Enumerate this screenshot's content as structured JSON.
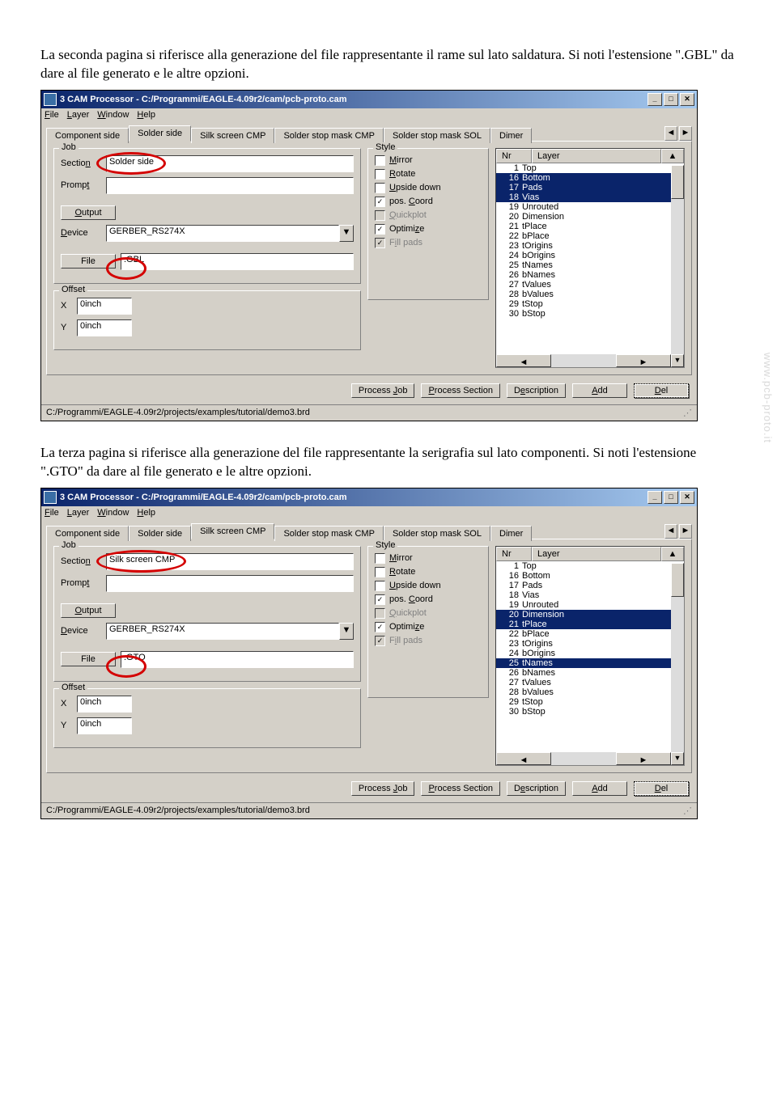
{
  "paragraph1": "La seconda pagina si riferisce alla generazione del file rappresentante il rame sul lato saldatura. Si noti l'estensione \".GBL\" da dare al file generato e le altre opzioni.",
  "paragraph2": "La terza pagina si riferisce alla generazione del file rappresentante la serigrafia sul lato componenti. Si noti l'estensione \".GTO\" da dare al file generato e le altre opzioni.",
  "watermark": "www.pcb-proto.it",
  "window": {
    "title": "3 CAM Processor - C:/Programmi/EAGLE-4.09r2/cam/pcb-proto.cam",
    "menu": [
      "File",
      "Layer",
      "Window",
      "Help"
    ],
    "tabs": [
      "Component side",
      "Solder side",
      "Silk screen CMP",
      "Solder stop mask CMP",
      "Solder stop mask SOL",
      "Dimer"
    ],
    "job_legend": "Job",
    "style_legend": "Style",
    "offset_legend": "Offset",
    "section_lbl": "Section",
    "prompt_lbl": "Prompt",
    "output_btn": "Output",
    "device_lbl": "Device",
    "device_val": "GERBER_RS274X",
    "file_btn": "File",
    "offset_x": "X",
    "offset_y": "Y",
    "offset_x_val": "0inch",
    "offset_y_val": "0inch",
    "chk": {
      "mirror": "Mirror",
      "rotate": "Rotate",
      "upside": "Upside down",
      "poscoord": "pos. Coord",
      "quickplot": "Quickplot",
      "optimize": "Optimize",
      "fillpads": "Fill pads"
    },
    "layer_hdr_nr": "Nr",
    "layer_hdr_layer": "Layer",
    "layers": [
      {
        "nr": "1",
        "name": "Top"
      },
      {
        "nr": "16",
        "name": "Bottom"
      },
      {
        "nr": "17",
        "name": "Pads"
      },
      {
        "nr": "18",
        "name": "Vias"
      },
      {
        "nr": "19",
        "name": "Unrouted"
      },
      {
        "nr": "20",
        "name": "Dimension"
      },
      {
        "nr": "21",
        "name": "tPlace"
      },
      {
        "nr": "22",
        "name": "bPlace"
      },
      {
        "nr": "23",
        "name": "tOrigins"
      },
      {
        "nr": "24",
        "name": "bOrigins"
      },
      {
        "nr": "25",
        "name": "tNames"
      },
      {
        "nr": "26",
        "name": "bNames"
      },
      {
        "nr": "27",
        "name": "tValues"
      },
      {
        "nr": "28",
        "name": "bValues"
      },
      {
        "nr": "29",
        "name": "tStop"
      },
      {
        "nr": "30",
        "name": "bStop"
      }
    ],
    "btn_processjob": "Process Job",
    "btn_processsection": "Process Section",
    "btn_description": "Description",
    "btn_add": "Add",
    "btn_del": "Del",
    "statusbar": "C:/Programmi/EAGLE-4.09r2/projects/examples/tutorial/demo3.brd"
  },
  "screenshot1": {
    "active_tab_index": 1,
    "section_val": "Solder side",
    "file_val": ".GBL",
    "selected_layers": [
      1,
      2,
      3
    ]
  },
  "screenshot2": {
    "active_tab_index": 2,
    "section_val": "Silk screen CMP",
    "file_val": ".GTO",
    "selected_layers": [
      5,
      6,
      10
    ]
  }
}
